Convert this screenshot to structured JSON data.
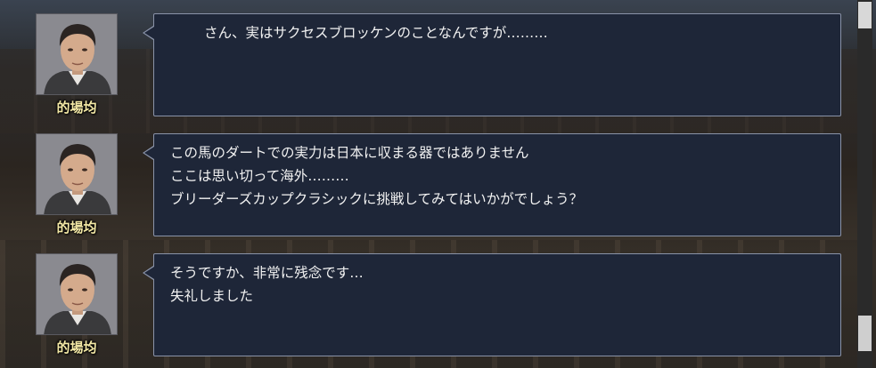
{
  "dialogue_log": [
    {
      "speaker": "的場均",
      "lines": "さん、実はサクセスブロッケンのことなんですが………"
    },
    {
      "speaker": "的場均",
      "lines": "この馬のダートでの実力は日本に収まる器ではありません\nここは思い切って海外………\nブリーダーズカップクラシックに挑戦してみてはいかがでしょう？"
    },
    {
      "speaker": "的場均",
      "lines": "そうですか、非常に残念です…\n失礼しました"
    }
  ],
  "colors": {
    "bubble_bg": "#1e2638",
    "bubble_border": "#8a93a8",
    "speaker_name": "#f4e9a6",
    "text": "#f2f2f2"
  },
  "icons": {
    "portrait": "trainer-portrait"
  }
}
